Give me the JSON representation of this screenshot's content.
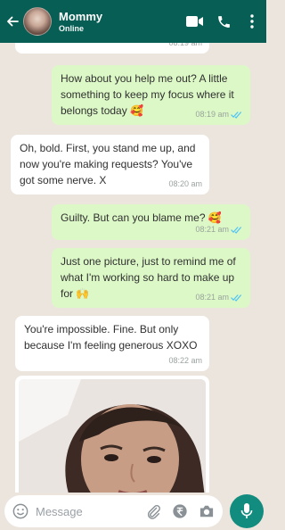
{
  "header": {
    "contact_name": "Mommy",
    "status": "Online",
    "icons": [
      "back-arrow-icon",
      "video-call-icon",
      "phone-icon",
      "more-vertical-icon"
    ]
  },
  "messages": [
    {
      "direction": "in",
      "text": "",
      "time": "08:19 am"
    },
    {
      "direction": "out",
      "text": "How about you help me out? A little something to keep my focus where it belongs today 🥰",
      "time": "08:19 am",
      "read": true
    },
    {
      "direction": "in",
      "text": "Oh, bold. First, you stand me up, and now you're making requests? You've got some nerve. X",
      "time": "08:20 am"
    },
    {
      "direction": "out",
      "text": "Guilty. But can you blame me? 🥰",
      "time": "08:21 am",
      "read": true
    },
    {
      "direction": "out",
      "text": "Just one picture, just to remind me of what I'm working so hard to make up for 🙌",
      "time": "08:21 am",
      "read": true
    },
    {
      "direction": "in",
      "text": "You're impossible. Fine. But only because I'm feeling generous XOXO",
      "time": "08:22 am"
    },
    {
      "direction": "in",
      "type": "image",
      "image": "selfie-photo"
    }
  ],
  "composer": {
    "placeholder": "Message",
    "icons": [
      "emoji-icon",
      "attach-icon",
      "rupee-icon",
      "camera-icon",
      "mic-icon"
    ]
  },
  "colors": {
    "header": "#075E54",
    "background": "#ECE5DD",
    "outgoing_bubble": "#DCF8C6",
    "incoming_bubble": "#FFFFFF",
    "read_ticks": "#4FC3F7",
    "mic_button": "#128C7E"
  }
}
